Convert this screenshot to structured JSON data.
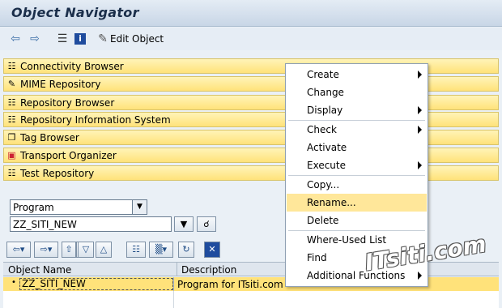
{
  "window": {
    "title": "Object Navigator"
  },
  "toolbar": {
    "edit_object_label": "Edit Object"
  },
  "navigator_rows": [
    {
      "label": "Connectivity Browser",
      "icon": "connectivity-icon"
    },
    {
      "label": "MIME Repository",
      "icon": "mime-icon"
    },
    {
      "label": "Repository Browser",
      "icon": "repository-icon"
    },
    {
      "label": "Repository Information System",
      "icon": "info-system-icon"
    },
    {
      "label": "Tag Browser",
      "icon": "tag-icon"
    },
    {
      "label": "Transport Organizer",
      "icon": "transport-icon"
    },
    {
      "label": "Test Repository",
      "icon": "test-icon"
    }
  ],
  "object_type_select": {
    "value": "Program"
  },
  "object_name_field": {
    "value": "ZZ_SITI_NEW"
  },
  "table": {
    "headers": [
      "Object Name",
      "Description"
    ],
    "rows": [
      {
        "name": "ZZ_SITI_NEW",
        "description": "Program for ITsiti.com"
      }
    ]
  },
  "context_menu": {
    "items": [
      {
        "label": "Create",
        "submenu": true
      },
      {
        "label": "Change",
        "submenu": false
      },
      {
        "label": "Display",
        "submenu": true
      },
      {
        "label": "Check",
        "submenu": true
      },
      {
        "label": "Activate",
        "submenu": false
      },
      {
        "label": "Execute",
        "submenu": true
      },
      {
        "label": "Copy...",
        "submenu": false
      },
      {
        "label": "Rename...",
        "submenu": false,
        "highlighted": true
      },
      {
        "label": "Delete",
        "submenu": false
      },
      {
        "label": "Where-Used List",
        "submenu": false
      },
      {
        "label": "Find",
        "submenu": false
      },
      {
        "label": "Additional Functions",
        "submenu": true
      }
    ]
  },
  "watermark": "ITsiti.com",
  "colors": {
    "highlight": "#ffe27a",
    "title": "#1a2e4a"
  }
}
